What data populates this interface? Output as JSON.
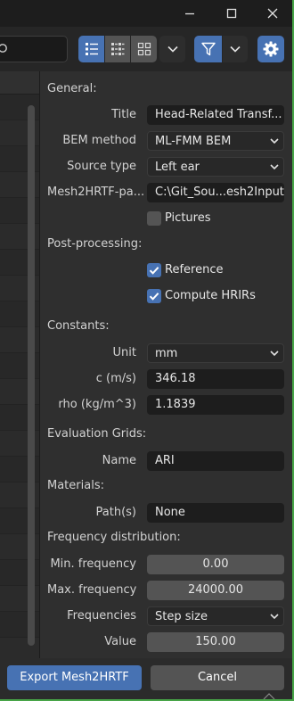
{
  "window": {
    "controls": [
      "minimize-icon",
      "maximize-icon",
      "close-icon"
    ]
  },
  "toolbar": {
    "search_icon": "search-icon",
    "view_buttons": [
      "list-vertical-icon",
      "list-horizontal-icon",
      "grid-thumbnails-icon"
    ],
    "filter_icon": "funnel-icon",
    "settings_icon": "gear-icon"
  },
  "form": {
    "general": {
      "heading": "General:",
      "title_label": "Title",
      "title_value": "Head-Related Transf...",
      "bem_label": "BEM method",
      "bem_value": "ML-FMM BEM",
      "source_label": "Source type",
      "source_value": "Left ear",
      "path_label": "Mesh2HRTF-pa...",
      "path_value": "C:\\Git_Sou...esh2Input",
      "pictures_label": "Pictures",
      "pictures_checked": false
    },
    "post": {
      "heading": "Post-processing:",
      "reference_label": "Reference",
      "reference_checked": true,
      "hrirs_label": "Compute HRIRs",
      "hrirs_checked": true
    },
    "constants": {
      "heading": "Constants:",
      "unit_label": "Unit",
      "unit_value": "mm",
      "c_label": "c (m/s)",
      "c_value": "346.18",
      "rho_label": "rho (kg/m^3)",
      "rho_value": "1.1839"
    },
    "evaluation": {
      "heading": "Evaluation Grids:",
      "name_label": "Name",
      "name_value": "ARI"
    },
    "materials": {
      "heading": "Materials:",
      "paths_label": "Path(s)",
      "paths_value": "None"
    },
    "frequency": {
      "heading": "Frequency distribution:",
      "min_label": "Min. frequency",
      "min_value": "0.00",
      "max_label": "Max. frequency",
      "max_value": "24000.00",
      "freqs_label": "Frequencies",
      "freqs_value": "Step size",
      "value_label": "Value",
      "value_value": "150.00"
    }
  },
  "footer": {
    "export_label": "Export Mesh2HRTF",
    "cancel_label": "Cancel"
  },
  "colors": {
    "accent": "#4772b3",
    "border_accent": "#47a447"
  }
}
